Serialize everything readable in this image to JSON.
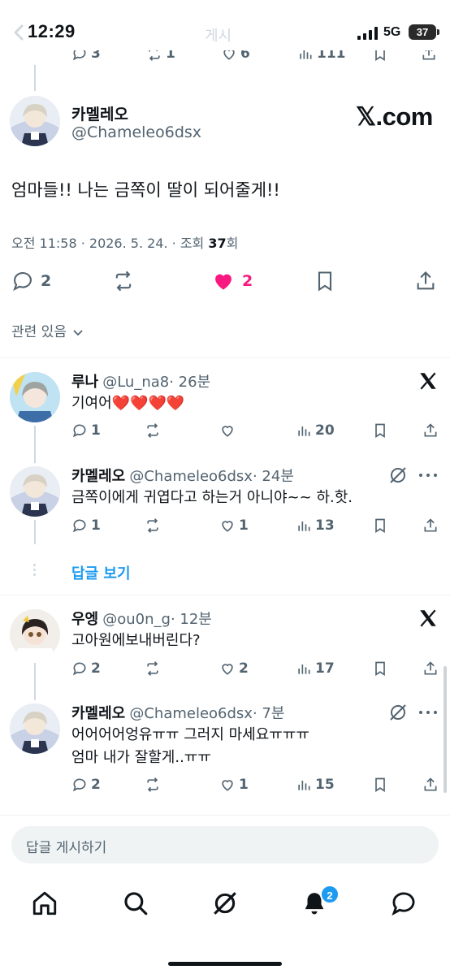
{
  "status_bar": {
    "time": "12:29",
    "faded_title": "게시",
    "network": "5G",
    "battery": "37"
  },
  "top_partial_actions": {
    "replies": "3",
    "reposts": "1",
    "likes": "6",
    "views": "111"
  },
  "main_post": {
    "author_name": "카멜레오",
    "author_handle": "@Chameleo6dsx",
    "source_label": "𝕏.com",
    "text": "엄마들!! 나는 금쪽이 딸이 되어줄게!!",
    "meta_prefix": "오전 11:58 · 2026. 5. 24. · 조회 ",
    "meta_views": "37",
    "meta_suffix": "회",
    "replies": "2",
    "likes": "2",
    "liked": true,
    "related_label": "관련 있음"
  },
  "replies": [
    {
      "name": "루나",
      "handle": "@Lu_na8",
      "time": "· 26분",
      "text": "기여어❤️❤️❤️❤️",
      "replies": "1",
      "likes": "",
      "views": "20",
      "badge": "x-logo"
    },
    {
      "name": "카멜레오",
      "handle": "@Chameleo6dsx",
      "time": "· 24분",
      "text": "금쪽이에게 귀엽다고 하는거 아니야~~ 하.핫.",
      "replies": "1",
      "likes": "1",
      "views": "13",
      "badge": "grok-icon"
    },
    {
      "name": "우엥",
      "handle": "@ou0n_g",
      "time": "· 12분",
      "text": "고아원에보내버린다?",
      "replies": "2",
      "likes": "2",
      "views": "17",
      "badge": "x-logo"
    },
    {
      "name": "카멜레오",
      "handle": "@Chameleo6dsx",
      "time": "· 7분",
      "text_line1": "어어어어엉유ㅠㅠ 그러지 마세요ㅠㅠㅠ",
      "text_line2": "엄마 내가 잘할게..ㅠㅠ",
      "replies": "2",
      "likes": "1",
      "views": "15",
      "badge": "grok-icon"
    }
  ],
  "show_replies_label": "답글 보기",
  "reply_input_placeholder": "답글 게시하기",
  "bottom_nav": {
    "notification_count": "2"
  },
  "colors": {
    "like": "#f91880",
    "accent": "#1d9bf0",
    "secondary_text": "#536471"
  }
}
